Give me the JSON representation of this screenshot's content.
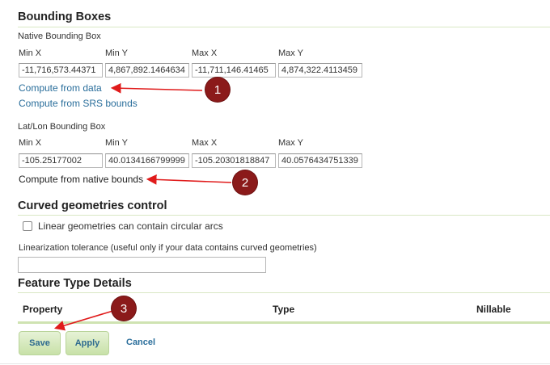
{
  "bounding_boxes": {
    "title": "Bounding Boxes",
    "native": {
      "label": "Native Bounding Box",
      "columns": [
        "Min X",
        "Min Y",
        "Max X",
        "Max Y"
      ],
      "values": [
        "-11,716,573.44371",
        "4,867,892.1464634",
        "-11,711,146.41465",
        "4,874,322.4113459"
      ],
      "compute_link": "Compute from data",
      "srs_link": "Compute from SRS bounds"
    },
    "latlon": {
      "label": "Lat/Lon Bounding Box",
      "columns": [
        "Min X",
        "Min Y",
        "Max X",
        "Max Y"
      ],
      "values": [
        "-105.25177002",
        "40.0134166799999",
        "-105.20301818847",
        "40.0576434751339"
      ],
      "compute_link": "Compute from native bounds"
    }
  },
  "curved": {
    "title": "Curved geometries control",
    "checkbox_label": "Linear geometries can contain circular arcs",
    "checkbox_checked": false,
    "tolerance_label": "Linearization tolerance (useful only if your data contains curved geometries)",
    "tolerance_value": ""
  },
  "feature_type": {
    "title": "Feature Type Details",
    "headers": [
      "Property",
      "Type",
      "Nillable"
    ]
  },
  "actions": {
    "save": "Save",
    "apply": "Apply",
    "cancel": "Cancel"
  },
  "annotations": [
    "1",
    "2",
    "3"
  ],
  "colors": {
    "annotation": "#8b1a1a",
    "arrow": "#e01b1b",
    "link": "#2a6e9b",
    "accent_green": "#c8e1a8"
  }
}
